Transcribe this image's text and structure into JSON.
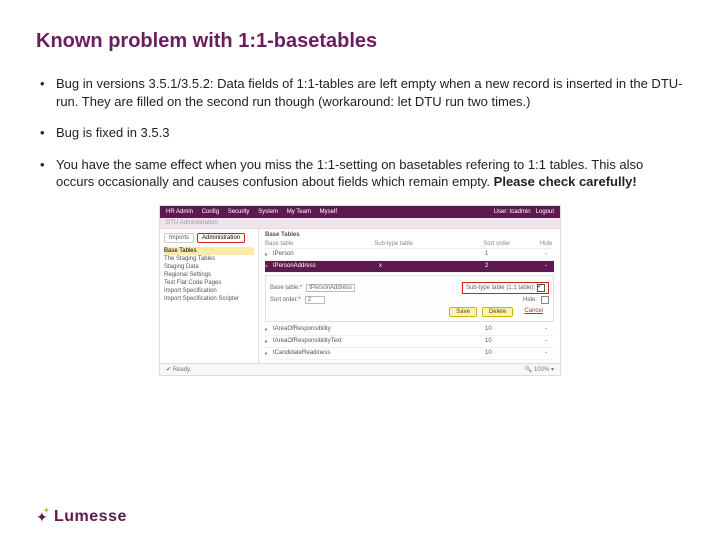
{
  "title": "Known problem with 1:1-basetables",
  "bullets": [
    {
      "text": "Bug in versions 3.5.1/3.5.2: Data fields of 1:1-tables are left empty when a new record is inserted in the DTU-run. They are filled on the second run though (workaround: let DTU run two times.)"
    },
    {
      "text": "Bug is fixed in 3.5.3"
    },
    {
      "text_a": "You have the same effect when you miss the 1:1-setting on basetables refering to 1:1 tables. This also occurs occasionally and causes confusion about fields which remain empty. ",
      "text_b": "Please check carefully!"
    }
  ],
  "app": {
    "nav": {
      "hr": "HR Admin",
      "config": "Config",
      "security": "Security",
      "system": "System",
      "myteam": "My Team",
      "myself": "Myself"
    },
    "user_label": "User: tcadmin",
    "logout": "Logout",
    "crumb": "DTU Administration",
    "tabs": {
      "imports": "Imports",
      "admin": "Administration"
    },
    "side": {
      "i0": "Base Tables",
      "i1": "The Staging Tables",
      "i2": "Staging Data",
      "i3": "Regional Settings",
      "i4": "Text Flat Code Pages",
      "i5": "Import Specification",
      "i6": "Import Specification Scripter"
    },
    "head": "Base Tables",
    "cols": {
      "c1": "Base table",
      "c2": "Sub-type table",
      "c3": "Sort order",
      "c4": "Hide"
    },
    "rows": {
      "r1": {
        "name": "tPerson",
        "sub": "",
        "sort": "1",
        "hide": "-"
      },
      "r2": {
        "name": "tPersonAddress",
        "sub": "x",
        "sort": "2",
        "hide": "-"
      },
      "r3": {
        "name": "tAreaOfResponsibility",
        "sub": "",
        "sort": "10",
        "hide": "-"
      },
      "r4": {
        "name": "tAreaOfResponsibilityText",
        "sub": "",
        "sort": "10",
        "hide": "-"
      },
      "r5": {
        "name": "tCandidateReadiness",
        "sub": "",
        "sort": "10",
        "hide": "-"
      }
    },
    "form": {
      "base_lbl": "Base table:*",
      "base_val": "tPersonAddress",
      "sub_lbl": "Sub-type table (1:1 table):",
      "sort_lbl": "Sort order:*",
      "sort_val": "2",
      "hide_lbl": "Hide:"
    },
    "btns": {
      "save": "Save",
      "delete": "Delete",
      "cancel": "Cancel"
    },
    "status": {
      "ready": "Ready.",
      "zoom": "100%"
    }
  },
  "logo": "Lumesse"
}
